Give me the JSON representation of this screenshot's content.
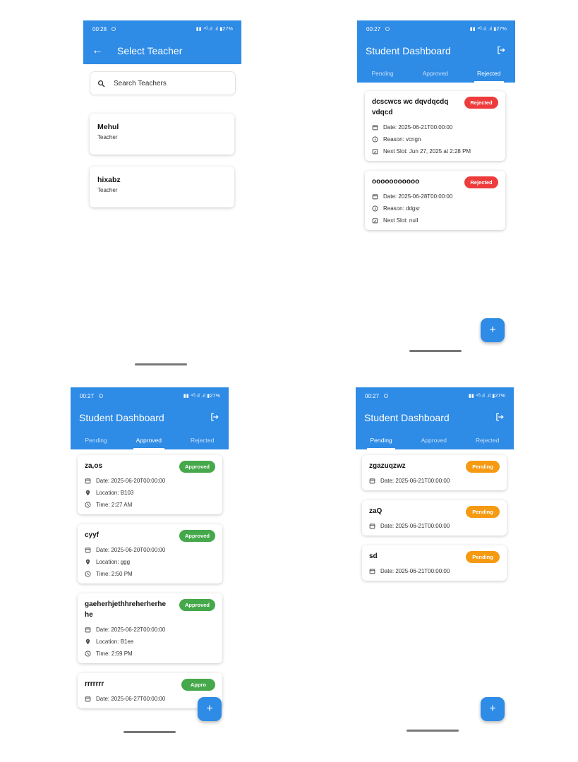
{
  "status_left_tl": "00:28",
  "status_left": "00:27",
  "status_right": "▮▮ ⁴ᴳ.ıl .ıl ▮27%",
  "select_teacher": {
    "title": "Select Teacher",
    "search_placeholder": "Search Teachers",
    "teachers": [
      {
        "name": "Mehul",
        "role": "Teacher"
      },
      {
        "name": "hixabz",
        "role": "Teacher"
      }
    ]
  },
  "dashboard": {
    "title": "Student Dashboard",
    "tabs": [
      "Pending",
      "Approved",
      "Rejected"
    ]
  },
  "rejected": [
    {
      "title": "dcscwcs wc dqvdqcdqvdqcd",
      "status": "Rejected",
      "date": "Date: 2025-06-21T00:00:00",
      "reason": "Reason: vcngn",
      "slot": "Next Slot: Jun 27, 2025 at 2:28 PM"
    },
    {
      "title": "ooooooooooo",
      "status": "Rejected",
      "date": "Date: 2025-06-28T00:00:00",
      "reason": "Reason: ddgsr",
      "slot": "Next Slot: null"
    }
  ],
  "approved": [
    {
      "title": "za,os",
      "status": "Approved",
      "date": "Date: 2025-06-20T00:00:00",
      "location": "Location: B103",
      "time": "Time: 2:27 AM"
    },
    {
      "title": "cyyf",
      "status": "Approved",
      "date": "Date: 2025-06-20T00:00:00",
      "location": "Location: ggg",
      "time": "Time: 2:50 PM"
    },
    {
      "title": "gaeherhjethhreherherhe he",
      "status": "Approved",
      "date": "Date: 2025-06-22T00:00:00",
      "location": "Location: B1ee",
      "time": "Time: 2:59 PM"
    },
    {
      "title": "rrrrrrr",
      "status": "Appro",
      "date": "Date: 2025-06-27T00:00:00"
    }
  ],
  "pending": [
    {
      "title": "zgazuqzwz",
      "status": "Pending",
      "date": "Date: 2025-06-21T00:00:00"
    },
    {
      "title": "zaQ",
      "status": "Pending",
      "date": "Date: 2025-06-21T00:00:00"
    },
    {
      "title": "sd",
      "status": "Pending",
      "date": "Date: 2025-06-21T00:00:00"
    }
  ],
  "fab_label": "+",
  "colors": {
    "primary": "#2e8be6",
    "rejected": "#ee3b3b",
    "approved": "#45a84a",
    "pending": "#f59a12"
  },
  "icons": [
    "back-arrow-icon",
    "search-icon",
    "logout-icon",
    "calendar-icon",
    "info-icon",
    "event-icon",
    "location-icon",
    "clock-icon"
  ]
}
